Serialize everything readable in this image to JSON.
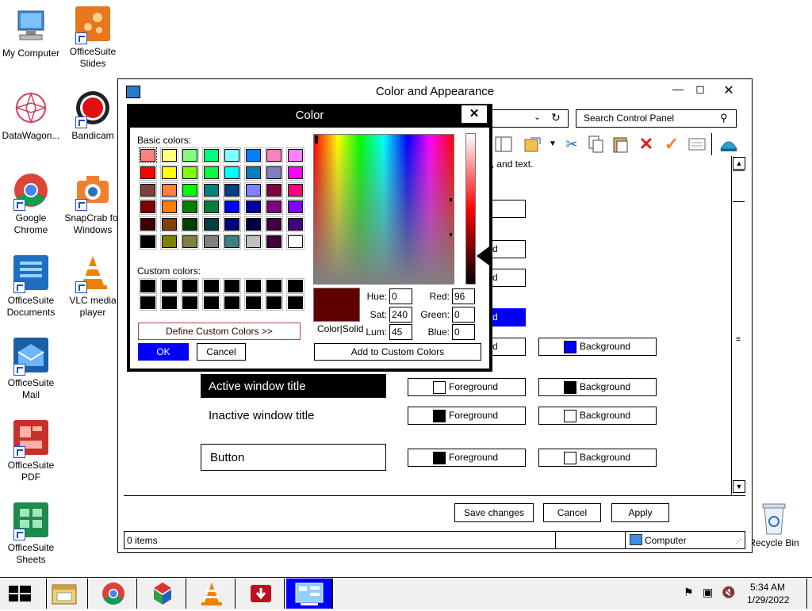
{
  "desktop": {
    "icons": [
      {
        "label": "My Computer"
      },
      {
        "label": "OfficeSuite Slides"
      },
      {
        "label": "DataWagon..."
      },
      {
        "label": "Bandicam"
      },
      {
        "label": "Google Chrome"
      },
      {
        "label": "SnapCrab for Windows"
      },
      {
        "label": "OfficeSuite Documents"
      },
      {
        "label": "VLC media player"
      },
      {
        "label": "OfficeSuite Mail"
      },
      {
        "label": "OfficeSuite PDF"
      },
      {
        "label": "OfficeSuite Sheets"
      },
      {
        "label": "Recycle Bin"
      }
    ]
  },
  "window": {
    "title": "Color and Appearance",
    "search_placeholder": "Search Control Panel",
    "hint_text": "ns, and text.",
    "rows": [
      {
        "preview": "Active window title",
        "fg": "Foreground",
        "bg": "Background"
      },
      {
        "preview": "Inactive window title",
        "fg": "Foreground",
        "bg": "Background"
      },
      {
        "preview": "Button",
        "fg": "Foreground",
        "bg": "Background"
      }
    ],
    "upper_bg_label": "Background",
    "partial_d": "d",
    "save_label": "Save changes",
    "cancel_label": "Cancel",
    "apply_label": "Apply",
    "status_items": "0 items",
    "status_computer": "Computer"
  },
  "color_dialog": {
    "title": "Color",
    "basic_colors_label": "Basic colors:",
    "custom_colors_label": "Custom colors:",
    "define_custom_label": "Define Custom Colors >>",
    "ok_label": "OK",
    "cancel_label": "Cancel",
    "add_custom_label": "Add to Custom Colors",
    "color_solid_label": "Color|Solid",
    "hue_label": "Hue:",
    "hue": "0",
    "sat_label": "Sat:",
    "sat": "240",
    "lum_label": "Lum:",
    "lum": "45",
    "red_label": "Red:",
    "red": "96",
    "green_label": "Green:",
    "green": "0",
    "blue_label": "Blue:",
    "blue": "0",
    "selected_color": "#600000",
    "basic_colors": [
      "#ff8080",
      "#ffff80",
      "#80ff80",
      "#00ff80",
      "#80ffff",
      "#0080ff",
      "#ff80c0",
      "#ff80ff",
      "#ff0000",
      "#ffff00",
      "#80ff00",
      "#00ff40",
      "#00ffff",
      "#0080c0",
      "#8080c0",
      "#ff00ff",
      "#804040",
      "#ff8040",
      "#00ff00",
      "#008080",
      "#004080",
      "#8080ff",
      "#800040",
      "#ff0080",
      "#800000",
      "#ff8000",
      "#008000",
      "#008040",
      "#0000ff",
      "#0000a0",
      "#800080",
      "#8000ff",
      "#400000",
      "#804000",
      "#004000",
      "#004040",
      "#000080",
      "#000040",
      "#400040",
      "#400080",
      "#000000",
      "#808000",
      "#808040",
      "#808080",
      "#408080",
      "#c0c0c0",
      "#400040",
      "#ffffff"
    ]
  },
  "taskbar": {
    "time": "5:34 AM",
    "date": "1/29/2022"
  }
}
